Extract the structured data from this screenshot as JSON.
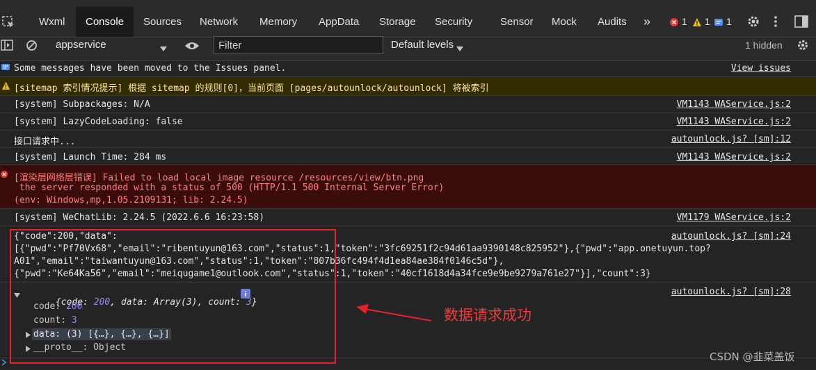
{
  "top_tabs": [
    {
      "label": "Wxml"
    },
    {
      "label": "Console"
    },
    {
      "label": "Sources"
    },
    {
      "label": "Network"
    },
    {
      "label": "Memory"
    },
    {
      "label": "AppData"
    },
    {
      "label": "Storage"
    },
    {
      "label": "Security"
    },
    {
      "label": "Sensor"
    },
    {
      "label": "Mock"
    },
    {
      "label": "Audits"
    }
  ],
  "more_tabs": "»",
  "counts": {
    "errors": "1",
    "warnings": "1",
    "infos": "1"
  },
  "toolbar": {
    "context": "appservice",
    "filter_placeholder": "Filter",
    "levels": "Default levels",
    "hidden": "1 hidden"
  },
  "messages": [
    {
      "text": "Some messages have been moved to the Issues panel.",
      "link": "View issues"
    },
    {
      "text": "[sitemap 索引情况提示] 根据 sitemap 的规则[0]，当前页面 [pages/autounlock/autounlock] 将被索引"
    },
    {
      "text": "[system] Subpackages: N/A",
      "link": "VM1143 WAService.js:2"
    },
    {
      "text": "[system] LazyCodeLoading: false",
      "link": "VM1143 WAService.js:2"
    },
    {
      "text": "接口请求中...",
      "link": "autounlock.js? [sm]:12"
    },
    {
      "text": "[system] Launch Time: 284 ms",
      "link": "VM1143 WAService.js:2"
    },
    {
      "line1": "[渲染层网络层错误] Failed to load local image resource /resources/view/btn.png",
      "line2": " the server responded with a status of 500 (HTTP/1.1 500 Internal Server Error)",
      "line3": "(env: Windows,mp,1.05.2109131; lib: 2.24.5)"
    },
    {
      "text": "[system] WeChatLib: 2.24.5 (2022.6.6 16:23:58)",
      "link": "VM1179 WAService.js:2"
    },
    {
      "line1": "{\"code\":200,\"data\":",
      "line2": "[{\"pwd\":\"Pf70Vx68\",\"email\":\"ribentuyun@163.com\",\"status\":1,\"token\":\"3fc69251f2c94d61aa9390148c825952\"},{\"pwd\":\"app.onetuyun.top?",
      "line3": "A01\",\"email\":\"taiwantuyun@163.com\",\"status\":1,\"token\":\"807b36fc494f4d1ea84ae384f0146c5d\"},",
      "line4": "{\"pwd\":\"Ke64Ka56\",\"email\":\"meiqugame1@outlook.com\",\"status\":1,\"token\":\"40cf1618d4a34fce9e9be9279a761e27\"}],\"count\":3}",
      "link": "autounlock.js? [sm]:24"
    },
    {
      "link": "autounlock.js? [sm]:28"
    }
  ],
  "object": {
    "summary_open": "{code: ",
    "summary_code": "200",
    "summary_mid": ", data: Array(3), count: ",
    "summary_count": "3",
    "summary_close": "}",
    "code_key": "code: ",
    "code_val": "200",
    "count_key": "count: ",
    "count_val": "3",
    "data_line": "data: (3) [{…}, {…}, {…}]",
    "proto_line": "__proto__: Object"
  },
  "annotation": "数据请求成功",
  "watermark": "CSDN @韭菜盖饭",
  "colors": {
    "error_red": "#e3242b",
    "warning_bg": "#332b00",
    "error_bg": "#3b0c0c",
    "accent_blue": "#4c8bf5"
  }
}
